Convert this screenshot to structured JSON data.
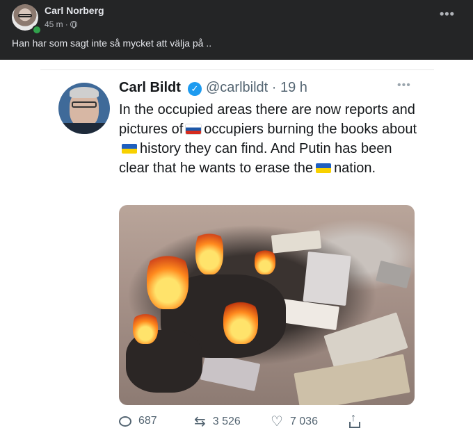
{
  "post": {
    "author": "Carl Norberg",
    "time": "45 m",
    "time_sep": "·",
    "more_label": "•••",
    "text": "Han har som sagt inte så mycket att välja på .."
  },
  "tweet": {
    "name": "Carl Bildt",
    "verified_mark": "✓",
    "handle": "@carlbildt",
    "time": "· 19 h",
    "more_label": "•••",
    "text_parts": {
      "p1": "In the occupied areas there are now reports and pictures of",
      "p2": "occupiers burning the books about",
      "p3": "history they can find. And Putin has been clear that he wants to erase the",
      "p4": "nation."
    },
    "flag_icons": [
      "russia-flag-icon",
      "ukraine-flag-icon",
      "ukraine-flag-icon"
    ],
    "stats": {
      "replies": "687",
      "retweets": "3 526",
      "likes": "7 036"
    }
  },
  "colors": {
    "fb_background": "#242526",
    "fb_text": "#e4e6eb",
    "fb_secondary": "#b0b3b8",
    "online_dot": "#31a24c",
    "twitter_blue": "#1d9bf0",
    "tweet_text": "#14171a",
    "tweet_secondary": "#536471"
  }
}
